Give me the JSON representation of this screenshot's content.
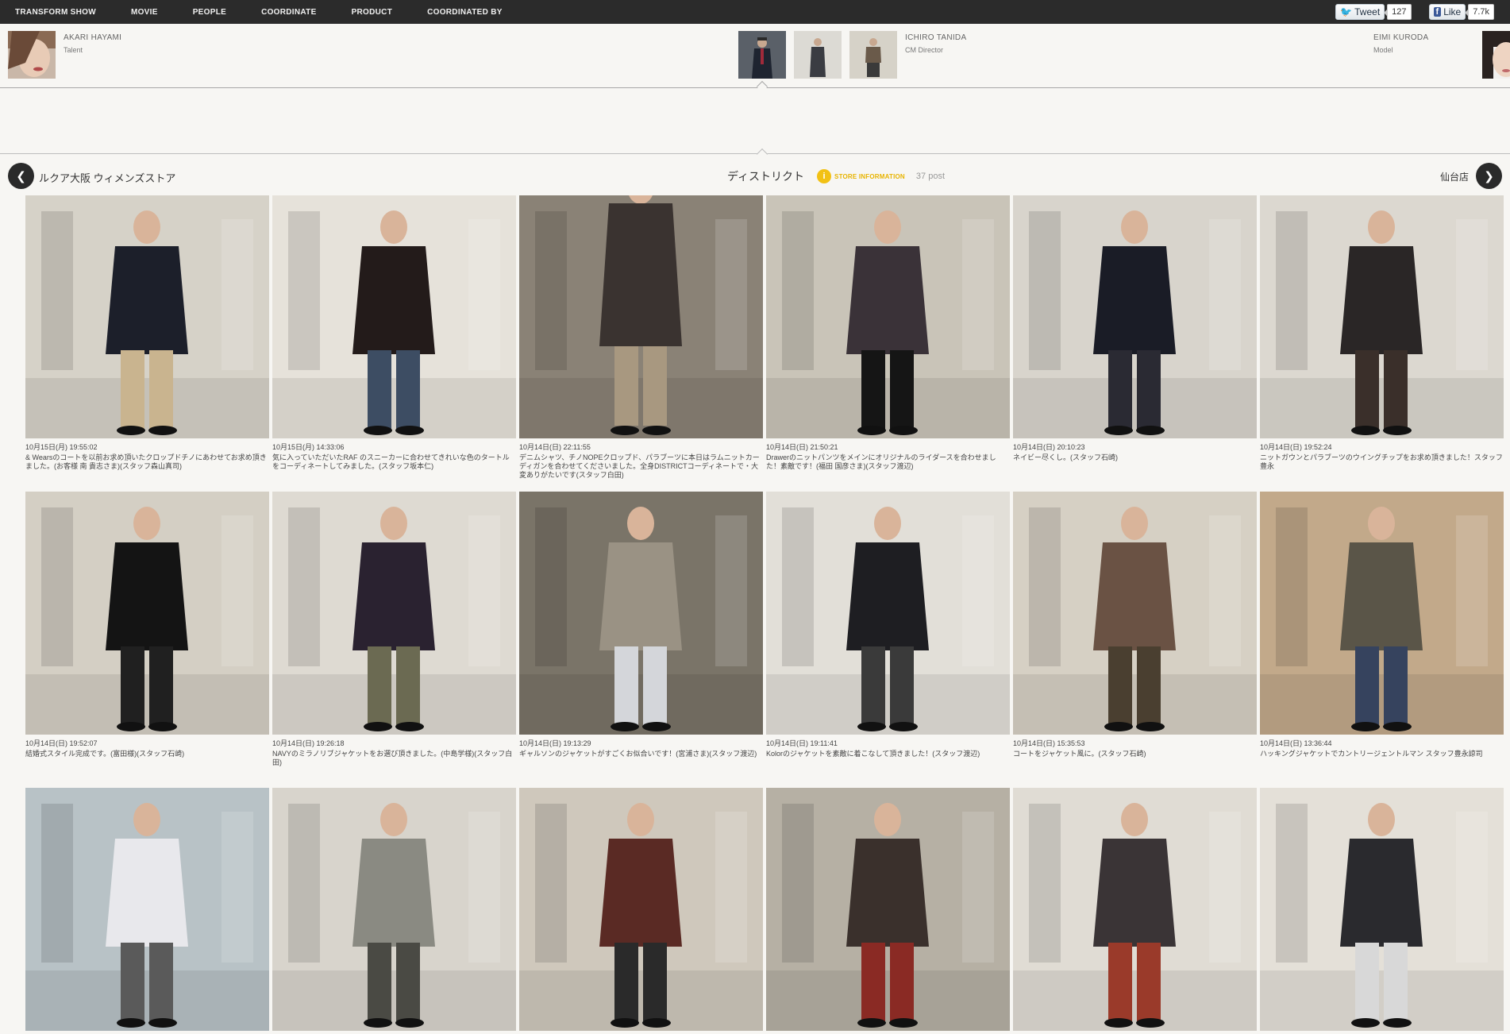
{
  "nav": {
    "items": [
      "TRANSFORM SHOW",
      "MOVIE",
      "PEOPLE",
      "COORDINATE",
      "PRODUCT",
      "COORDINATED BY"
    ],
    "tweet_label": "Tweet",
    "tweet_count": "127",
    "like_label": "Like",
    "like_count": "7.7k"
  },
  "people": {
    "left": {
      "name": "AKARI HAYAMI",
      "role": "Talent"
    },
    "center": {
      "name": "ICHIRO TANIDA",
      "role": "CM Director"
    },
    "right": {
      "name": "EIMI KURODA",
      "role": "Model"
    }
  },
  "store": {
    "prev": "ルクア大阪 ウィメンズストア",
    "current": "ディストリクト",
    "info_icon": "i",
    "info_label": "STORE INFORMATION",
    "post_count": "37 post",
    "next": "仙台店"
  },
  "posts": [
    {
      "date": "10月15日(月) 19:55:02",
      "caption": "& Wearsのコートを以前お求め頂いたクロップドチノにあわせてお求め頂きました。(お客様 南 貴志さま)(スタッフ森山真司)",
      "colors": [
        "#d6d2c8",
        "#1c1f2a",
        "#c9b48f"
      ]
    },
    {
      "date": "10月15日(月) 14:33:06",
      "caption": "気に入っていただいたRAF のスニーカーに合わせてきれいな色のタートルをコーディネートしてみました。(スタッフ坂本仁)",
      "colors": [
        "#e6e2da",
        "#231b1a",
        "#3d4d63"
      ]
    },
    {
      "date": "10月14日(日) 22:11:55",
      "caption": "デニムシャツ、チノNOPEクロップド、パラブーツに本日はラムニットカーディガンを合わせてくださいました。全身DISTRICTコーディネートで・大変ありがたいです(スタッフ白田)",
      "colors": [
        "#8a8276",
        "#3a3330",
        "#a89880"
      ]
    },
    {
      "date": "10月14日(日) 21:50:21",
      "caption": "Drawerのニットパンツをメインにオリジナルのライダースを合わせました！素敵です！(福田 国彦さま)(スタッフ渡辺)",
      "colors": [
        "#c9c4b8",
        "#3a3238",
        "#151515"
      ]
    },
    {
      "date": "10月14日(日) 20:10:23",
      "caption": "ネイビー尽くし。(スタッフ石崎)",
      "colors": [
        "#d8d4cc",
        "#1a1c26",
        "#2a2a33"
      ]
    },
    {
      "date": "10月14日(日) 19:52:24",
      "caption": "ニットガウンとパラブーツのウイングチップをお求め頂きました！スタッフ豊永",
      "colors": [
        "#dcd8d0",
        "#2a2626",
        "#3a2f2a"
      ]
    },
    {
      "date": "10月14日(日) 19:52:07",
      "caption": "結婚式スタイル完成です。(富田様)(スタッフ石崎)",
      "colors": [
        "#d4cfc4",
        "#141414",
        "#202020"
      ]
    },
    {
      "date": "10月14日(日) 19:26:18",
      "caption": "NAVYのミラノリブジャケットをお選び頂きました。(中島学様)(スタッフ白田)",
      "colors": [
        "#dedad2",
        "#2a2230",
        "#6b6a52"
      ]
    },
    {
      "date": "10月14日(日) 19:13:29",
      "caption": "ギャルソンのジャケットがすごくお似合いです！(宮浦さま)(スタッフ渡辺)",
      "colors": [
        "#7a7468",
        "#9a9284",
        "#d4d6da"
      ]
    },
    {
      "date": "10月14日(日) 19:11:41",
      "caption": "Kolorのジャケットを素敵に着こなして頂きました！(スタッフ渡辺)",
      "colors": [
        "#e2dfd8",
        "#1e1e22",
        "#3a3a3a"
      ]
    },
    {
      "date": "10月14日(日) 15:35:53",
      "caption": "コートをジャケット風に。(スタッフ石崎)",
      "colors": [
        "#d6d0c4",
        "#6a5244",
        "#4a3f30"
      ]
    },
    {
      "date": "10月14日(日) 13:36:44",
      "caption": "ハッキングジャケットでカントリージェントルマン スタッフ豊永諒司",
      "colors": [
        "#c2a98a",
        "#5a5548",
        "#36435e"
      ]
    },
    {
      "date": "",
      "caption": "",
      "colors": [
        "#b8c2c6",
        "#e8e8ec",
        "#5a5a5a"
      ]
    },
    {
      "date": "",
      "caption": "",
      "colors": [
        "#d8d4cc",
        "#8a8a82",
        "#4a4a44"
      ]
    },
    {
      "date": "",
      "caption": "",
      "colors": [
        "#cfc8bc",
        "#5a2a24",
        "#2a2a2a"
      ]
    },
    {
      "date": "",
      "caption": "",
      "colors": [
        "#b6b0a4",
        "#3a302c",
        "#8a2a24"
      ]
    },
    {
      "date": "",
      "caption": "",
      "colors": [
        "#e0dcd4",
        "#3a3436",
        "#9a3a2a"
      ]
    },
    {
      "date": "",
      "caption": "",
      "colors": [
        "#e4e0d8",
        "#2a2a2e",
        "#d8d8d8"
      ]
    }
  ]
}
